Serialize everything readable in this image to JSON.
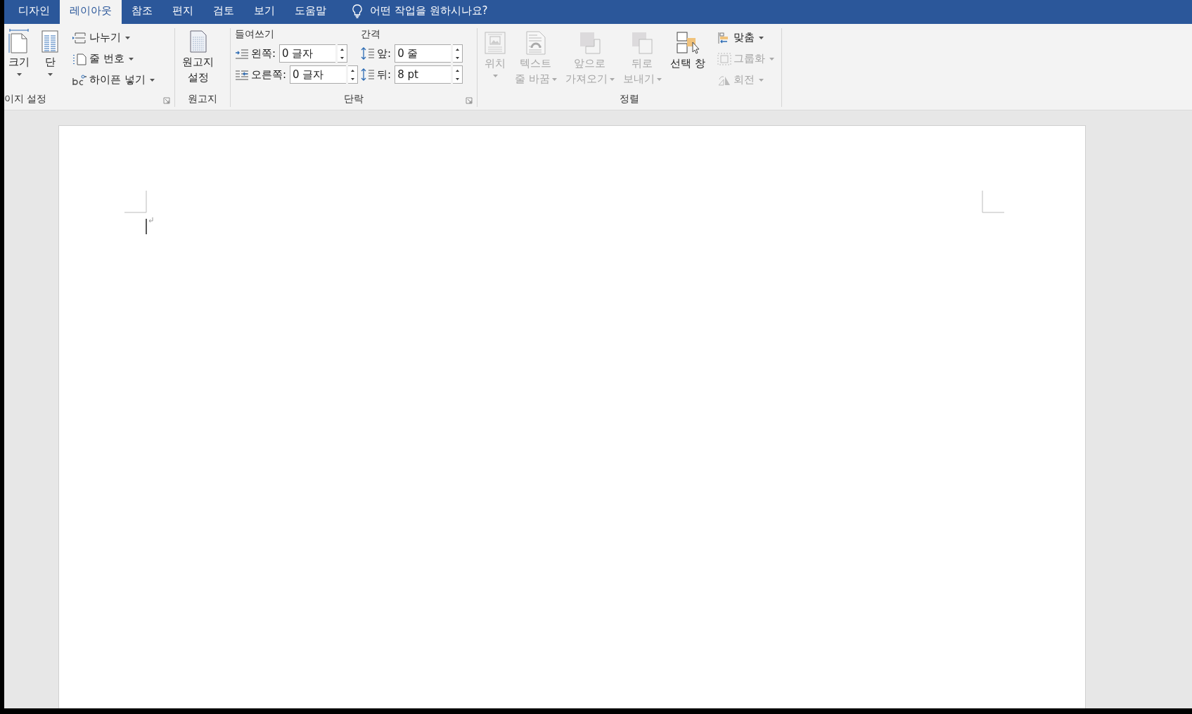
{
  "tabs": [
    {
      "label": "디자인",
      "selected": false
    },
    {
      "label": "레이아웃",
      "selected": true
    },
    {
      "label": "참조",
      "selected": false
    },
    {
      "label": "편지",
      "selected": false
    },
    {
      "label": "검토",
      "selected": false
    },
    {
      "label": "보기",
      "selected": false
    },
    {
      "label": "도움말",
      "selected": false
    }
  ],
  "tell_me": "어떤 작업을 원하시나요?",
  "page_setup": {
    "label": "이지 설정",
    "big_buttons": [
      {
        "label": "크기",
        "dropdown": true
      },
      {
        "label": "단",
        "dropdown": true
      }
    ],
    "small_buttons": [
      {
        "label": "나누기",
        "dropdown": true
      },
      {
        "label": "줄 번호",
        "dropdown": true
      },
      {
        "label": "하이픈 넣기",
        "dropdown": true
      }
    ]
  },
  "manuscript": {
    "label": "원고지",
    "button": [
      "원고지",
      "설정"
    ]
  },
  "paragraph": {
    "label": "단락",
    "indent_label": "들여쓰기",
    "spacing_label": "간격",
    "indent": [
      {
        "label": "왼쪽:",
        "value": "0 글자"
      },
      {
        "label": "오른쪽:",
        "value": "0 글자"
      }
    ],
    "spacing": [
      {
        "label": "앞:",
        "value": "0 줄"
      },
      {
        "label": "뒤:",
        "value": "8 pt"
      }
    ]
  },
  "arrange": {
    "label": "정렬",
    "big_buttons": [
      {
        "lines": [
          "위치"
        ],
        "dropdown": true,
        "disabled": true
      },
      {
        "lines": [
          "텍스트",
          "줄 바꿈"
        ],
        "dropdown": true,
        "disabled": true
      },
      {
        "lines": [
          "앞으로",
          "가져오기"
        ],
        "dropdown": true,
        "disabled": true
      },
      {
        "lines": [
          "뒤로",
          "보내기"
        ],
        "dropdown": true,
        "disabled": true
      },
      {
        "lines": [
          "선택 창"
        ],
        "dropdown": false,
        "disabled": false
      }
    ],
    "small_buttons": [
      {
        "label": "맞춤",
        "dropdown": true,
        "disabled": false
      },
      {
        "label": "그룹화",
        "dropdown": true,
        "disabled": true
      },
      {
        "label": "회전",
        "dropdown": true,
        "disabled": true
      }
    ]
  }
}
